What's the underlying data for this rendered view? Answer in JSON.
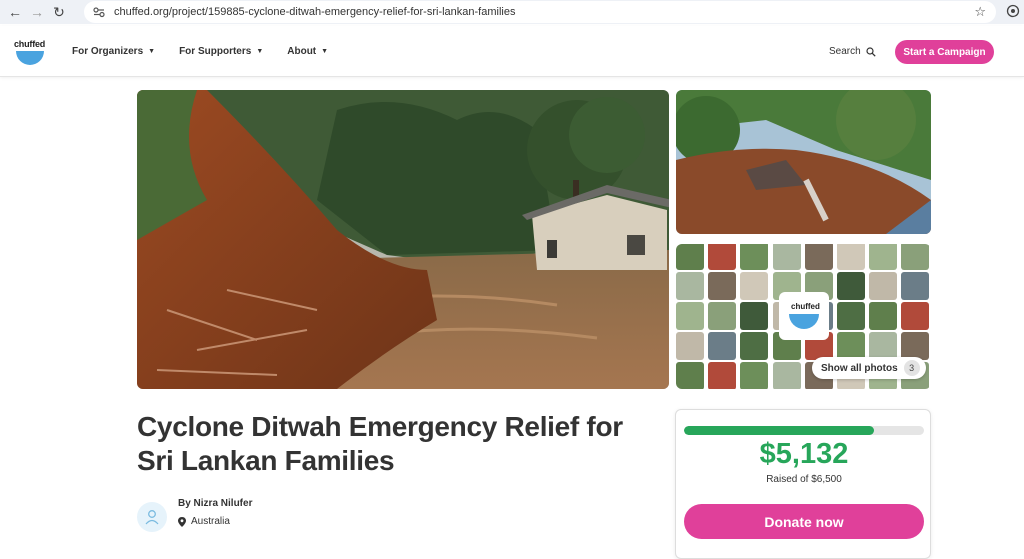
{
  "browser": {
    "url": "chuffed.org/project/159885-cyclone-ditwah-emergency-relief-for-sri-lankan-families"
  },
  "header": {
    "logo_text": "chuffed",
    "nav": [
      {
        "label": "For Organizers"
      },
      {
        "label": "For Supporters"
      },
      {
        "label": "About"
      }
    ],
    "search_label": "Search",
    "cta_label": "Start a Campaign"
  },
  "gallery": {
    "collage_logo_text": "chuffed",
    "show_all_label": "Show all photos",
    "photo_count": "3"
  },
  "campaign": {
    "title": "Cyclone Ditwah Emergency Relief for Sri Lankan Families",
    "organizer": "By Nizra Nilufer",
    "location": "Australia"
  },
  "donation": {
    "raised": "$5,132",
    "goal_text": "Raised of $6,500",
    "progress_fraction": 0.79,
    "donate_label": "Donate now"
  },
  "colors": {
    "brand_pink": "#e0409a",
    "progress_green": "#27a65a",
    "logo_blue": "#4aa3df"
  }
}
